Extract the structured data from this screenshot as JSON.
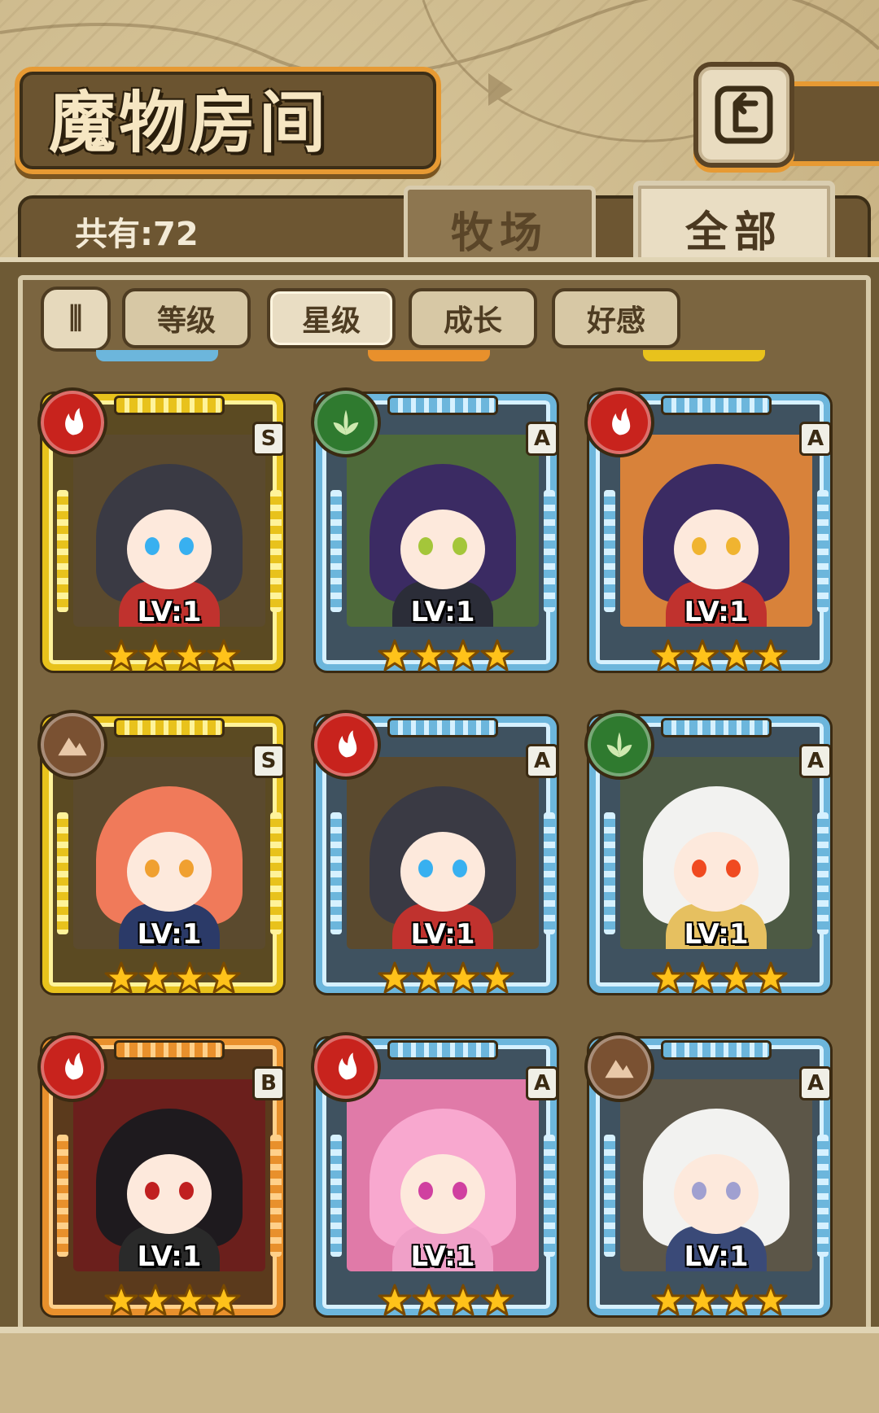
{
  "header": {
    "title": "魔物房间",
    "count_label": "共有:72",
    "back_icon": "return-arrow-icon"
  },
  "tabs": [
    {
      "label": "牧场",
      "selected": false
    },
    {
      "label": "全部",
      "selected": true
    }
  ],
  "filters": {
    "toggle_label": "⫼",
    "buttons": [
      {
        "label": "等级",
        "selected": false
      },
      {
        "label": "星级",
        "selected": true
      },
      {
        "label": "成长",
        "selected": false
      },
      {
        "label": "好感",
        "selected": false
      }
    ]
  },
  "colors": {
    "gold_frame": "#e8c21c",
    "blue_frame": "#6cb6dc",
    "orange_frame": "#e8902c",
    "fire": "#c8231d",
    "leaf": "#2f7a2f",
    "earth": "#7a5132",
    "star": "#ffc21a"
  },
  "monsters": [
    {
      "rank": "S",
      "level": "LV:1",
      "stars": 4,
      "element": "fire-icon",
      "frame": "gold"
    },
    {
      "rank": "A",
      "level": "LV:1",
      "stars": 4,
      "element": "leaf-icon",
      "frame": "blue"
    },
    {
      "rank": "A",
      "level": "LV:1",
      "stars": 4,
      "element": "fire-icon",
      "frame": "blue"
    },
    {
      "rank": "S",
      "level": "LV:1",
      "stars": 4,
      "element": "earth-icon",
      "frame": "gold"
    },
    {
      "rank": "A",
      "level": "LV:1",
      "stars": 4,
      "element": "fire-icon",
      "frame": "blue"
    },
    {
      "rank": "A",
      "level": "LV:1",
      "stars": 4,
      "element": "leaf-icon",
      "frame": "blue"
    },
    {
      "rank": "B",
      "level": "LV:1",
      "stars": 4,
      "element": "fire-icon",
      "frame": "orange"
    },
    {
      "rank": "A",
      "level": "LV:1",
      "stars": 4,
      "element": "fire-icon",
      "frame": "blue"
    },
    {
      "rank": "A",
      "level": "LV:1",
      "stars": 4,
      "element": "earth-icon",
      "frame": "blue"
    }
  ]
}
